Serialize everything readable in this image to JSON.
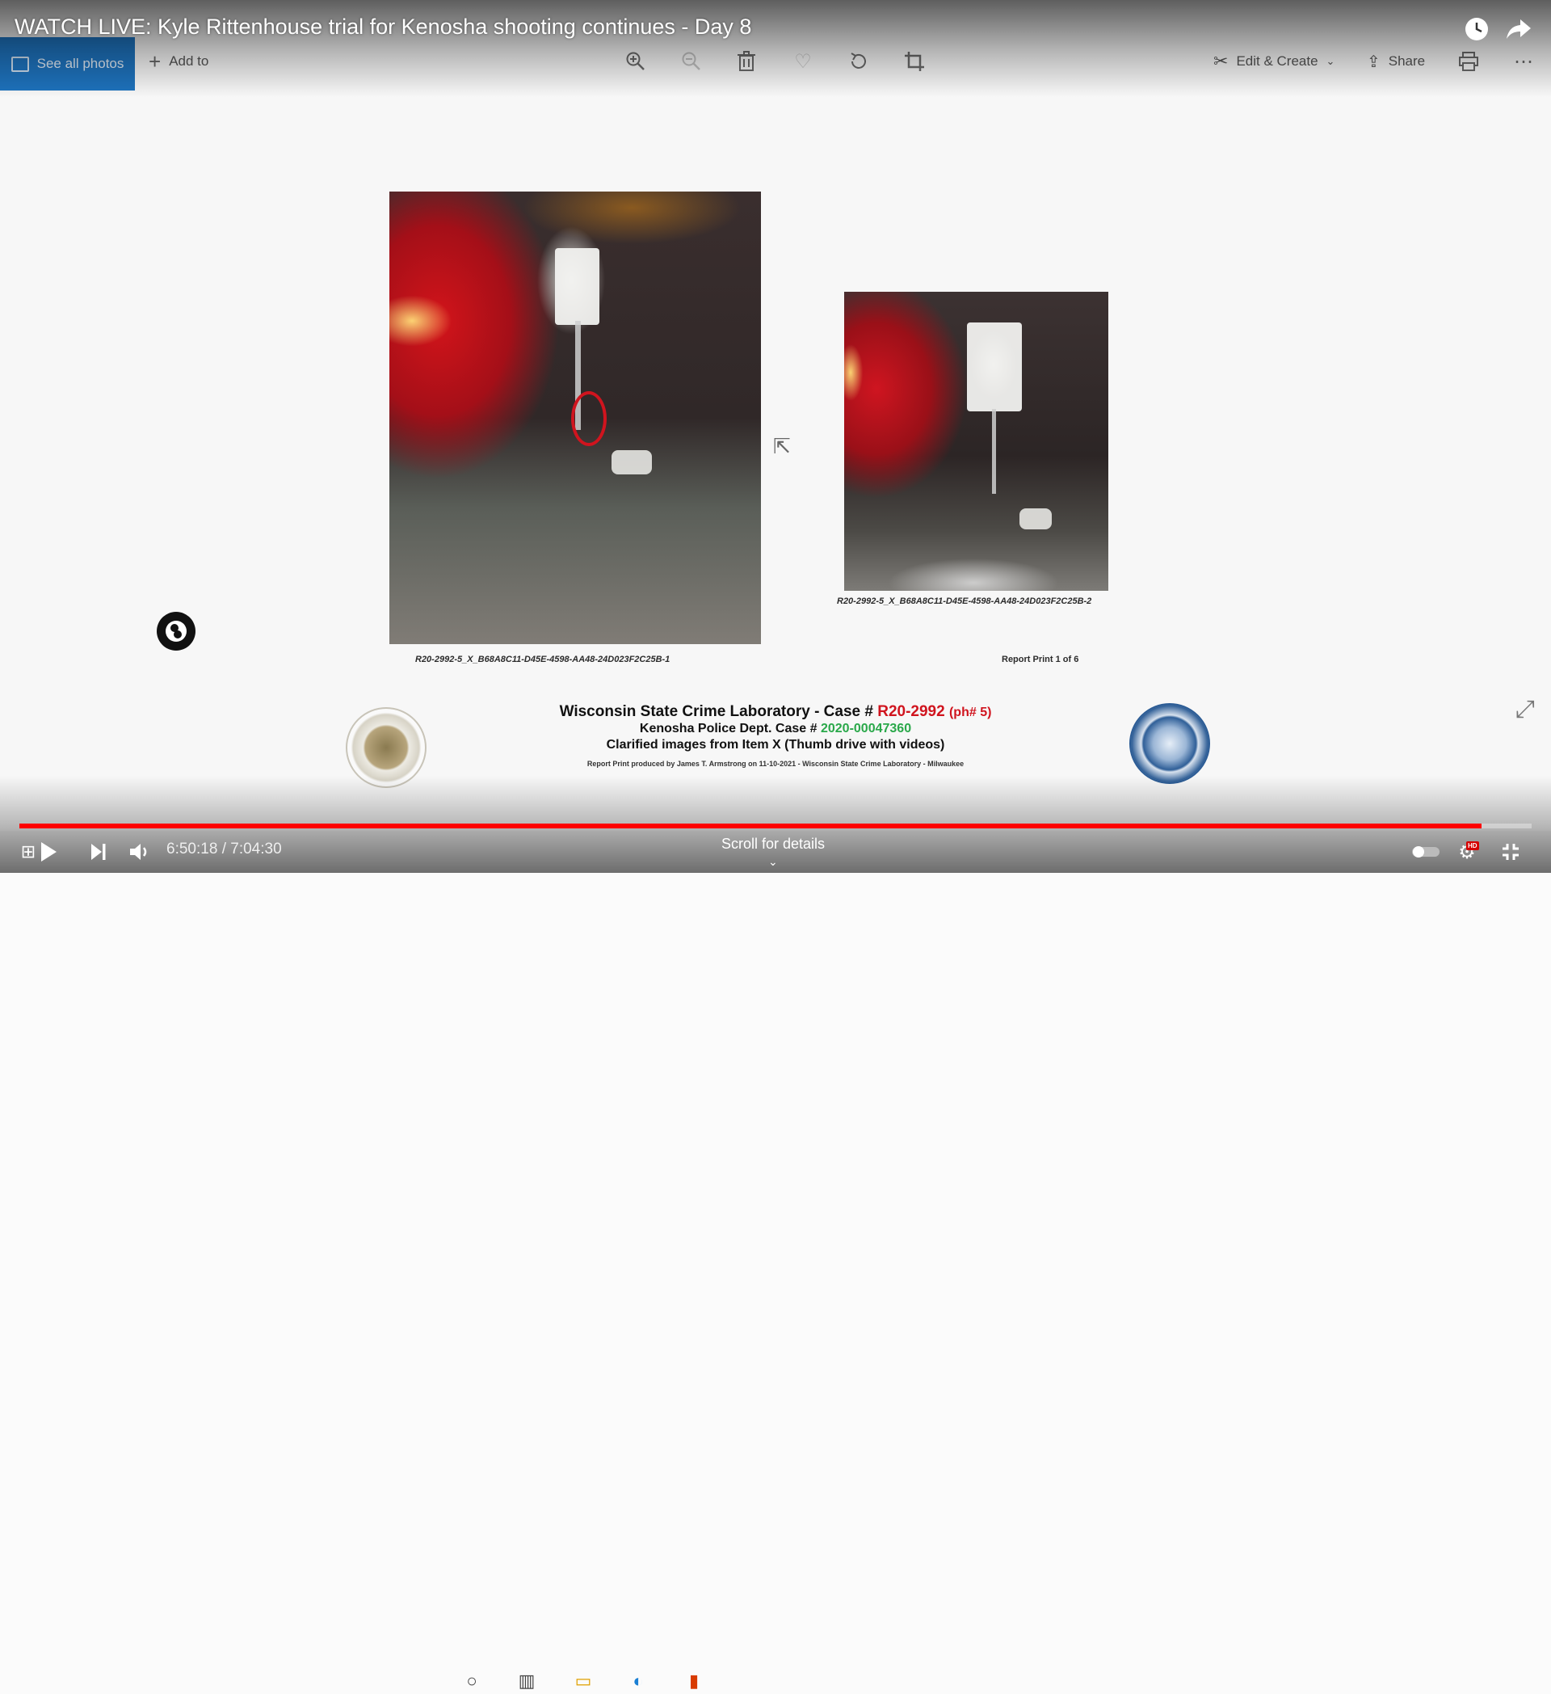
{
  "video": {
    "title": "WATCH LIVE: Kyle Rittenhouse trial for Kenosha shooting continues - Day 8",
    "time_current": "6:50:18",
    "time_separator": "/",
    "time_total": "7:04:30",
    "progress": 0.967,
    "scroll_hint": "Scroll for details",
    "quality_badge": "HD",
    "accent_color": "#ff0000"
  },
  "photos_toolbar": {
    "see_all_label": "See all photos",
    "add_to_label": "Add to",
    "edit_create_label": "Edit & Create",
    "share_label": "Share"
  },
  "slide": {
    "caption_left": "R20-2992-5_X_B68A8C11-D45E-4598-AA48-24D023F2C25B-1",
    "caption_right": "R20-2992-5_X_B68A8C11-D45E-4598-AA48-24D023F2C25B-2",
    "report_page": "Report Print 1 of 6",
    "lab_line1_prefix": "Wisconsin State Crime Laboratory - Case #",
    "lab_case_number": "R20-2992",
    "lab_case_suffix": "(ph# 5)",
    "police_line_prefix": "Kenosha Police Dept. Case #",
    "police_case_number": "2020-00047360",
    "clarified_line": "Clarified images from Item X (Thumb drive with videos)",
    "credit_line": "Report Print produced by James T. Armstrong on 11-10-2021 - Wisconsin State Crime Laboratory - Milwaukee"
  },
  "icons": {
    "zoom_in": "zoom-in-icon",
    "zoom_out": "zoom-out-icon",
    "delete": "trash-icon",
    "favorite": "heart-icon",
    "rotate": "rotate-icon",
    "crop": "crop-icon",
    "print": "print-icon",
    "more": "more-icon",
    "watch_later": "clock-icon",
    "share_video": "share-arrow-icon"
  }
}
